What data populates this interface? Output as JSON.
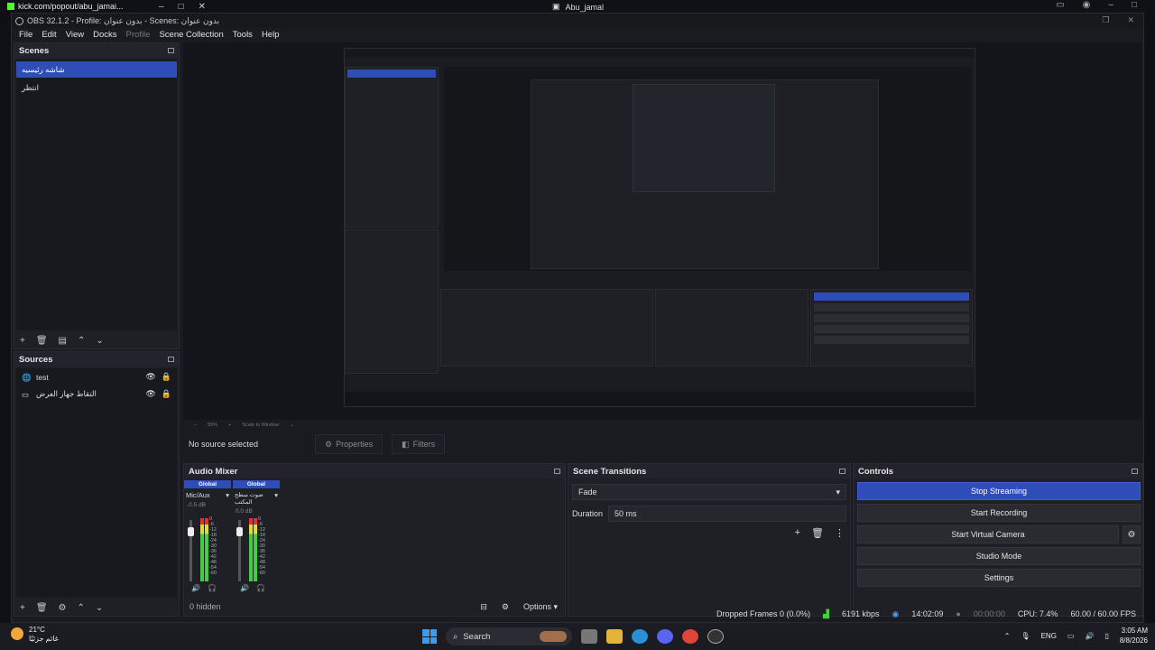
{
  "browser": {
    "tab_title": "kick.com/popout/abu_jamai...",
    "center_title": "Abu_jamal"
  },
  "obs": {
    "window_title": "OBS 32.1.2 - Profile: بدون عنوان - Scenes: بدون عنوان",
    "menu": [
      "File",
      "Edit",
      "View",
      "Docks",
      "Profile",
      "Scene Collection",
      "Tools",
      "Help"
    ],
    "scenes": {
      "header": "Scenes",
      "items": [
        "شاشه رئيسيه",
        "انتظر"
      ]
    },
    "sources": {
      "header": "Sources",
      "items": [
        {
          "name": "test",
          "icon": "globe-icon"
        },
        {
          "name": "التقاط جهاز العرض",
          "icon": "monitor-icon"
        }
      ]
    },
    "preview_zoom": {
      "zoom": "55%",
      "scale": "Scale to Window"
    },
    "source_toolbar": {
      "no_selection": "No source selected",
      "properties": "Properties",
      "filters": "Filters"
    },
    "audio_mixer": {
      "header": "Audio Mixer",
      "channels": [
        {
          "tag": "Global",
          "name": "Mic/Aux",
          "db": "-2.5 dB",
          "level": 0.62
        },
        {
          "tag": "Global",
          "name": "صوت سطح المكتب",
          "db": "0.0 dB",
          "level": 0.6
        }
      ],
      "scale": [
        "0",
        "-6",
        "-12",
        "-18",
        "-24",
        "-30",
        "-36",
        "-42",
        "-48",
        "-54",
        "-60"
      ],
      "hidden": "0 hidden",
      "options": "Options"
    },
    "transitions": {
      "header": "Scene Transitions",
      "selected": "Fade",
      "duration_label": "Duration",
      "duration_value": "50 ms"
    },
    "controls": {
      "header": "Controls",
      "buttons": [
        "Stop Streaming",
        "Start Recording",
        "Start Virtual Camera",
        "Studio Mode",
        "Settings"
      ]
    },
    "status": {
      "dropped": "Dropped Frames 0 (0.0%)",
      "bitrate": "6191 kbps",
      "stream_time": "14:02:09",
      "record_time": "00:00:00",
      "cpu": "CPU: 7.4%",
      "fps": "60.00 / 60.00 FPS"
    }
  },
  "taskbar": {
    "weather_temp": "21°C",
    "weather_desc": "غائم جزئيًا",
    "search": "Search",
    "lang": "ENG",
    "time": "3:05 AM",
    "date": "8/8/2026"
  },
  "colors": {
    "accent": "#2e4db8",
    "dock_bg": "#1f2026"
  }
}
